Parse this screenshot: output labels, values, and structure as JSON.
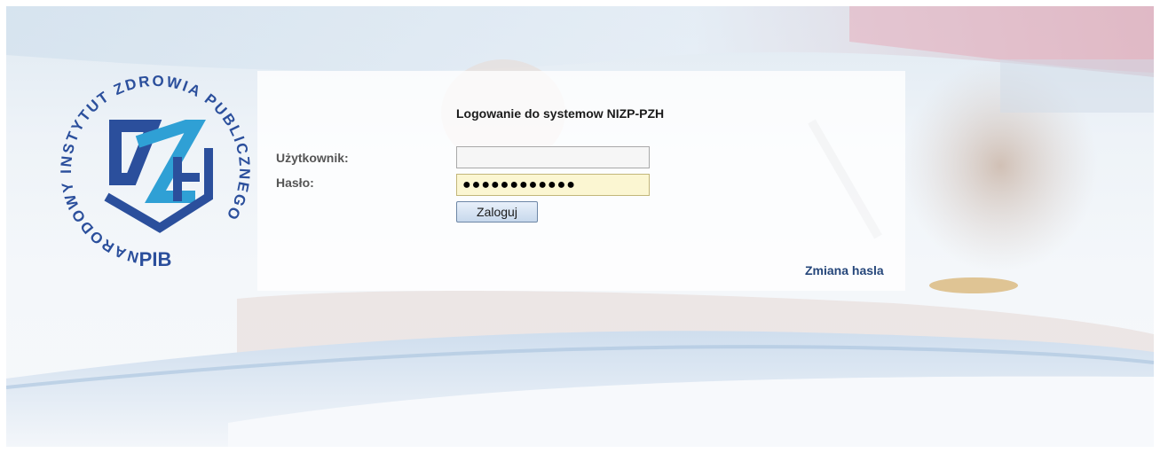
{
  "logo": {
    "ring_text": "NARODOWY INSTYTUT ZDROWIA PUBLICZNEGO",
    "bottom_text": "PIB",
    "monogram": "PZH"
  },
  "login": {
    "title": "Logowanie do systemow NIZP-PZH",
    "username_label": "Użytkownik:",
    "username_value": "",
    "password_label": "Hasło:",
    "password_value": "●●●●●●●●●●●●",
    "submit_label": "Zaloguj",
    "change_password_link": "Zmiana hasla"
  },
  "colors": {
    "brand_blue": "#25467a",
    "accent_red": "#e0435a",
    "logo_blue": "#2b4f9c",
    "logo_cyan": "#2fa0d5"
  }
}
